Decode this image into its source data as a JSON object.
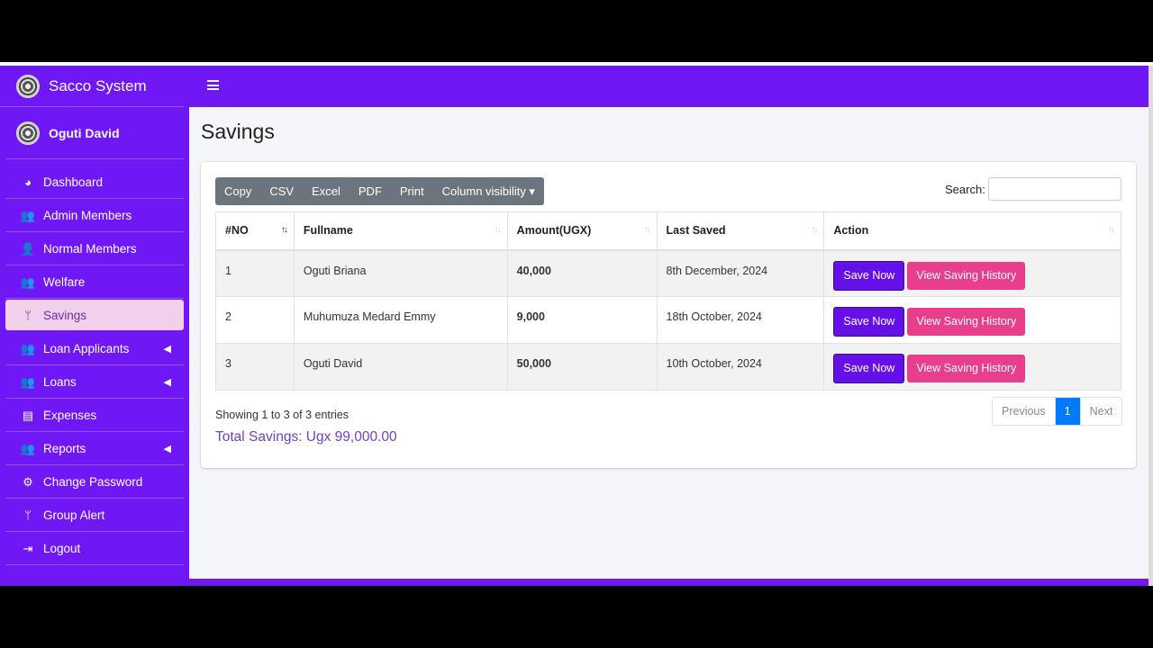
{
  "brand": {
    "title": "Sacco System"
  },
  "user": {
    "name": "Oguti David"
  },
  "sidebar": {
    "items": [
      {
        "label": "Dashboard",
        "icon": "gauge-icon",
        "glyph": "◕",
        "active": false,
        "caret": false
      },
      {
        "label": "Admin Members",
        "icon": "users-icon",
        "glyph": "👥",
        "active": false,
        "caret": false
      },
      {
        "label": "Normal Members",
        "icon": "user-icon",
        "glyph": "👤",
        "active": false,
        "caret": false
      },
      {
        "label": "Welfare",
        "icon": "users-icon",
        "glyph": "👥",
        "active": false,
        "caret": false
      },
      {
        "label": "Savings",
        "icon": "code-branch-icon",
        "glyph": "ᛘ",
        "active": true,
        "caret": false
      },
      {
        "label": "Loan Applicants",
        "icon": "users-icon",
        "glyph": "👥",
        "active": false,
        "caret": true
      },
      {
        "label": "Loans",
        "icon": "users-icon",
        "glyph": "👥",
        "active": false,
        "caret": true
      },
      {
        "label": "Expenses",
        "icon": "money-check-icon",
        "glyph": "▤",
        "active": false,
        "caret": false
      },
      {
        "label": "Reports",
        "icon": "users-icon",
        "glyph": "👥",
        "active": false,
        "caret": true
      },
      {
        "label": "Change Password",
        "icon": "cogs-icon",
        "glyph": "⚙",
        "active": false,
        "caret": false
      },
      {
        "label": "Group Alert",
        "icon": "code-branch-icon",
        "glyph": "ᛘ",
        "active": false,
        "caret": false
      },
      {
        "label": "Logout",
        "icon": "sign-out-icon",
        "glyph": "⇥",
        "active": false,
        "caret": false
      }
    ]
  },
  "page": {
    "title": "Savings"
  },
  "toolbar": {
    "buttons": [
      "Copy",
      "CSV",
      "Excel",
      "PDF",
      "Print",
      "Column visibility ▾"
    ]
  },
  "search": {
    "label": "Search:",
    "value": ""
  },
  "table": {
    "headers": [
      "#NO",
      "Fullname",
      "Amount(UGX)",
      "Last Saved",
      "Action"
    ],
    "rows": [
      {
        "no": "1",
        "name": "Oguti Briana",
        "amount": "40,000",
        "last": "8th December, 2024"
      },
      {
        "no": "2",
        "name": "Muhumuza Medard Emmy",
        "amount": "9,000",
        "last": "18th October, 2024"
      },
      {
        "no": "3",
        "name": "Oguti David",
        "amount": "50,000",
        "last": "10th October, 2024"
      }
    ],
    "save_label": "Save Now",
    "history_label": "View Saving History"
  },
  "footer": {
    "info": "Showing 1 to 3 of 3 entries",
    "total": "Total Savings: Ugx 99,000.00",
    "pager": {
      "prev": "Previous",
      "current": "1",
      "next": "Next"
    }
  },
  "colors": {
    "accent": "#7017f5",
    "save": "#6510e8",
    "history": "#e83e8c",
    "active_bg": "#f0d0ea",
    "pager_active": "#007bff",
    "total": "#6f42c1"
  }
}
